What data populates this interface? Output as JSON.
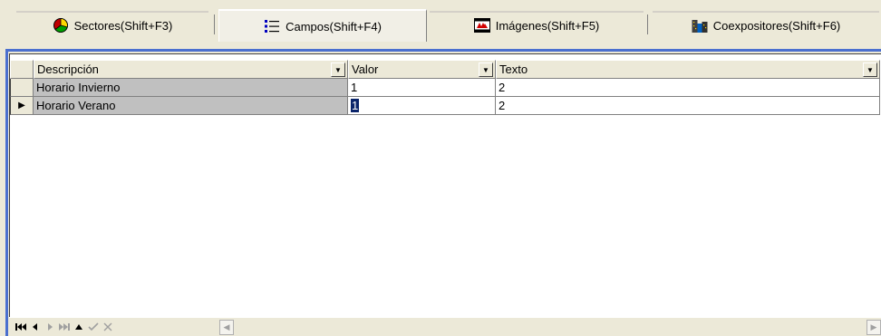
{
  "tabs": [
    {
      "label": "Sectores(Shift+F3)",
      "icon": "sectors-icon"
    },
    {
      "label": "Campos(Shift+F4)",
      "icon": "list-icon",
      "active": true
    },
    {
      "label": "Imágenes(Shift+F5)",
      "icon": "film-icon"
    },
    {
      "label": "Coexpositores(Shift+F6)",
      "icon": "buildings-icon"
    }
  ],
  "grid": {
    "columns": [
      "Descripción",
      "Valor",
      "Texto"
    ],
    "rows": [
      {
        "descripcion": "Horario Invierno",
        "valor": "1",
        "texto": "2"
      },
      {
        "descripcion": "Horario Verano",
        "valor": "1",
        "texto": "2",
        "current": true
      }
    ]
  },
  "navigator": {
    "buttons": [
      "first",
      "prior",
      "next",
      "last",
      "insert",
      "post",
      "cancel"
    ]
  },
  "colors": {
    "panel_border": "#4a6fcf",
    "selection": "#0a246a",
    "desc_column": "#c0c0c0"
  }
}
